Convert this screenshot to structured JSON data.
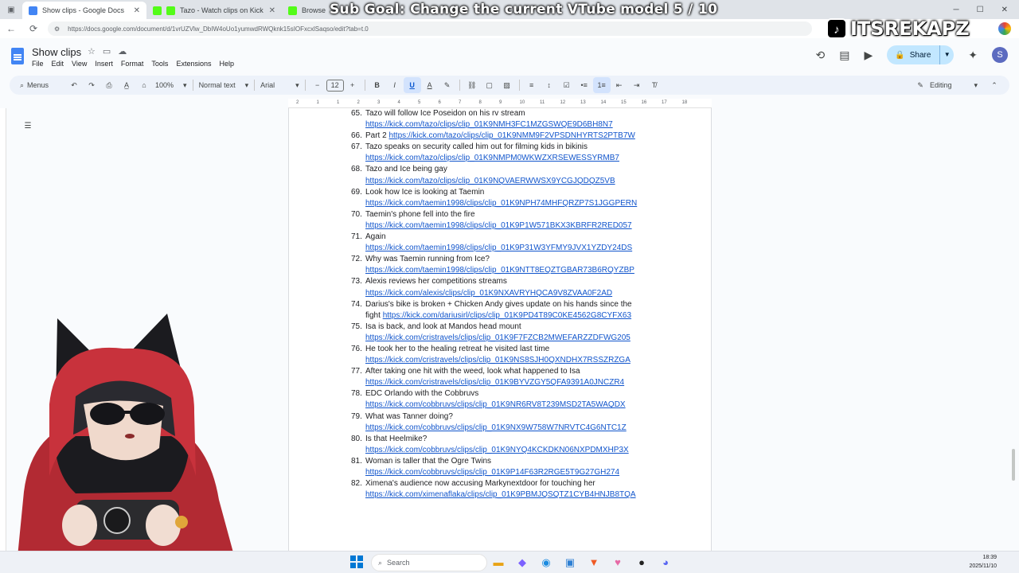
{
  "browser": {
    "tabs": [
      {
        "title": "Show clips - Google Docs",
        "active": true,
        "icon": "docs-icon"
      },
      {
        "title": "Tazo - Watch clips on Kick",
        "active": false,
        "icon": "kick-icon"
      },
      {
        "title": "Browse",
        "active": false,
        "icon": "kick-icon"
      }
    ],
    "url": "https://docs.google.com/document/d/1vrUZVlw_DbIW4oUo1yumwdRWQknk15sIOFxcxlSaqso/edit?tab=t.0"
  },
  "stream_overlay": {
    "goal_text": "Sub Goal: Change the current VTube model  5 / 10",
    "channel_name": "ITSREKAPZ"
  },
  "docs": {
    "title": "Show clips",
    "menu": [
      "File",
      "Edit",
      "View",
      "Insert",
      "Format",
      "Tools",
      "Extensions",
      "Help"
    ],
    "share_label": "Share",
    "avatar_letter": "S",
    "toolbar": {
      "menus_label": "Menus",
      "zoom": "100%",
      "style": "Normal text",
      "font": "Arial",
      "font_size": "12",
      "mode": "Editing"
    },
    "ruler_marks": [
      "2",
      "1",
      "1",
      "2",
      "3",
      "4",
      "5",
      "6",
      "7",
      "8",
      "9",
      "10",
      "11",
      "12",
      "13",
      "14",
      "15",
      "16",
      "17",
      "18"
    ],
    "items": [
      {
        "n": "65.",
        "text": "Tazo will follow Ice Poseidon on his rv stream",
        "pre": "",
        "link": "https://kick.com/tazo/clips/clip_01K9NMH3FC1MZGSWQE9D6BH8N7"
      },
      {
        "n": "66.",
        "text": "",
        "pre": "Part 2 ",
        "link": "https://kick.com/tazo/clips/clip_01K9NMM9F2VPSDNHYRTS2PTB7W"
      },
      {
        "n": "67.",
        "text": "Tazo speaks on security called him out for filming kids in bikinis",
        "pre": "",
        "link": "https://kick.com/tazo/clips/clip_01K9NMPM0WKWZXRSEWESSYRMB7"
      },
      {
        "n": "68.",
        "text": "Tazo and Ice being gay",
        "pre": "",
        "link": "https://kick.com/tazo/clips/clip_01K9NQVAERWWSX9YCGJQDQZ5VB"
      },
      {
        "n": "69.",
        "text": "Look how Ice is looking at Taemin",
        "pre": "",
        "link": "https://kick.com/taemin1998/clips/clip_01K9NPH74MHFQRZP7S1JGGPERN"
      },
      {
        "n": "70.",
        "text": "Taemin's phone fell into the fire",
        "pre": "",
        "link": "https://kick.com/taemin1998/clips/clip_01K9P1W571BKX3KBRFR2RED057"
      },
      {
        "n": "71.",
        "text": "Again",
        "pre": "",
        "link": "https://kick.com/taemin1998/clips/clip_01K9P31W3YFMY9JVX1YZDY24DS"
      },
      {
        "n": "72.",
        "text": "Why was Taemin running from Ice?",
        "pre": "",
        "link": "https://kick.com/taemin1998/clips/clip_01K9NTT8EQZTGBAR73B6RQYZBP"
      },
      {
        "n": "73.",
        "text": "Alexis reviews her competitions streams",
        "pre": "",
        "link": "https://kick.com/alexis/clips/clip_01K9NXAVRYHQCA9V8ZVAA0F2AD"
      },
      {
        "n": "74.",
        "text": "Darius's bike is broken + Chicken Andy gives update on his hands since the",
        "pre": "fight ",
        "link": "https://kick.com/dariusirl/clips/clip_01K9PD4T89C0KE4562G8CYFX63"
      },
      {
        "n": "75.",
        "text": "Isa is back, and look at Mandos head mount",
        "pre": "",
        "link": "https://kick.com/cristravels/clips/clip_01K9F7FZCB2MWEFARZZDFWG205"
      },
      {
        "n": "76.",
        "text": "He took her to the healing retreat he visited last time",
        "pre": "",
        "link": "https://kick.com/cristravels/clips/clip_01K9NS8SJH0QXNDHX7RSSZRZGA"
      },
      {
        "n": "77.",
        "text": "After taking one hit with the weed, look what happened to Isa",
        "pre": "",
        "link": "https://kick.com/cristravels/clips/clip_01K9BYVZGY5QFA9391A0JNCZR4"
      },
      {
        "n": "78.",
        "text": "EDC Orlando with the Cobbruvs",
        "pre": "",
        "link": "https://kick.com/cobbruvs/clips/clip_01K9NR6RV8T239MSD2TA5WAQDX"
      },
      {
        "n": "79.",
        "text": "What was Tanner doing?",
        "pre": "",
        "link": "https://kick.com/cobbruvs/clips/clip_01K9NX9W758W7NRVTC4G6NTC1Z"
      },
      {
        "n": "80.",
        "text": "Is that Heelmike?",
        "pre": "",
        "link": "https://kick.com/cobbruvs/clips/clip_01K9NYQ4KCKDKN06NXPDMXHP3X"
      },
      {
        "n": "81.",
        "text": "Woman is taller that the Ogre Twins",
        "pre": "",
        "link": "https://kick.com/cobbruvs/clips/clip_01K9P14F63R2RGE5T9G27GH274"
      },
      {
        "n": "82.",
        "text": "Ximena's audience now accusing Markynextdoor for touching her",
        "pre": "",
        "link": "https://kick.com/ximenaflaka/clips/clip_01K9PBMJQSQTZ1CYB4HNJB8TQA"
      }
    ]
  },
  "taskbar": {
    "search_placeholder": "Search",
    "time": "18:39",
    "date": "2025/11/10"
  }
}
